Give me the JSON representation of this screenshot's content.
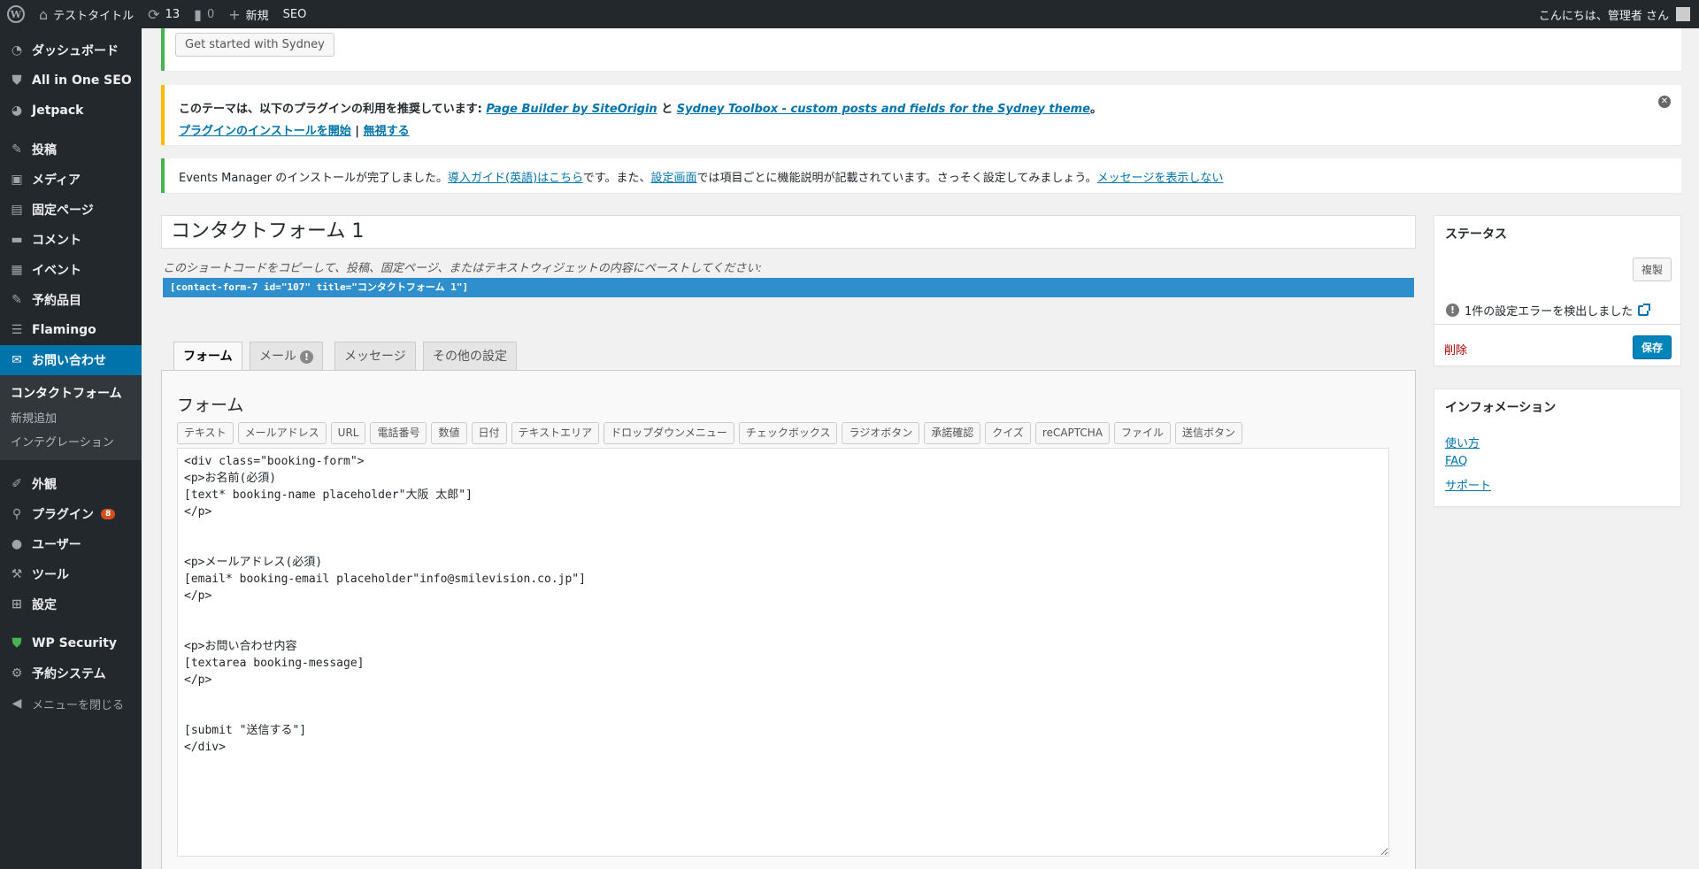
{
  "adminbar": {
    "site_title": "テストタイトル",
    "updates_count": "13",
    "comments_count": "0",
    "new_label": "新規",
    "seo_label": "SEO",
    "greeting": "こんにちは、管理者 さん"
  },
  "sidebar": {
    "items": [
      {
        "label": "ダッシュボード",
        "icon": "dashboard-icon"
      },
      {
        "label": "All in One SEO",
        "icon": "shield-icon"
      },
      {
        "label": "Jetpack",
        "icon": "jetpack-icon"
      },
      {
        "label": "投稿",
        "icon": "pin-icon"
      },
      {
        "label": "メディア",
        "icon": "media-icon"
      },
      {
        "label": "固定ページ",
        "icon": "page-icon"
      },
      {
        "label": "コメント",
        "icon": "comment-icon"
      },
      {
        "label": "イベント",
        "icon": "calendar-icon"
      },
      {
        "label": "予約品目",
        "icon": "pin-icon"
      },
      {
        "label": "Flamingo",
        "icon": "list-icon"
      },
      {
        "label": "お問い合わせ",
        "icon": "mail-icon"
      },
      {
        "label": "外観",
        "icon": "brush-icon"
      },
      {
        "label": "プラグイン",
        "icon": "plugin-icon",
        "badge": "8"
      },
      {
        "label": "ユーザー",
        "icon": "user-icon"
      },
      {
        "label": "ツール",
        "icon": "wrench-icon"
      },
      {
        "label": "設定",
        "icon": "settings-icon"
      },
      {
        "label": "WP Security",
        "icon": "security-shield-icon"
      },
      {
        "label": "予約システム",
        "icon": "gear-icon"
      },
      {
        "label": "メニューを閉じる",
        "icon": "collapse-icon"
      }
    ],
    "submenu": [
      "コンタクトフォーム",
      "新規追加",
      "インテグレーション"
    ]
  },
  "notices": {
    "sydney_button": "Get started with Sydney",
    "recommend_text": "このテーマは、以下のプラグインの利用を推奨しています: ",
    "plugin1": "Page Builder by SiteOrigin",
    "and": " と ",
    "plugin2": "Sydney Toolbox - custom posts and fields for the Sydney theme",
    "period": "。",
    "install_link": "プラグインのインストールを開始",
    "separator": " | ",
    "dismiss_link": "無視する",
    "em_text1": "Events Manager のインストールが完了しました。",
    "em_link1": "導入ガイド(英語)はこちら",
    "em_text2": "です。また、",
    "em_link2": "設定画面",
    "em_text3": "では項目ごとに機能説明が記載されています。さっそく設定してみましょう。",
    "em_link3": "メッセージを表示しない"
  },
  "form": {
    "title": "コンタクトフォーム 1",
    "shortcode_desc": "このショートコードをコピーして、投稿、固定ページ、またはテキストウィジェットの内容にペーストしてください:",
    "shortcode": "[contact-form-7 id=\"107\" title=\"コンタクトフォーム 1\"]",
    "tabs": [
      "フォーム",
      "メール",
      "メッセージ",
      "その他の設定"
    ],
    "panel_title": "フォーム",
    "tags": [
      "テキスト",
      "メールアドレス",
      "URL",
      "電話番号",
      "数値",
      "日付",
      "テキストエリア",
      "ドロップダウンメニュー",
      "チェックボックス",
      "ラジオボタン",
      "承諾確認",
      "クイズ",
      "reCAPTCHA",
      "ファイル",
      "送信ボタン"
    ],
    "editor_content": "<div class=\"booking-form\">\n<p>お名前(必須)\n[text* booking-name placeholder\"大阪 太郎\"]\n</p>\n\n\n<p>メールアドレス(必須)\n[email* booking-email placeholder\"info@smilevision.co.jp\"]\n</p>\n\n\n<p>お問い合わせ内容\n[textarea booking-message]\n</p>\n\n\n[submit \"送信する\"]\n</div>"
  },
  "status_box": {
    "title": "ステータス",
    "duplicate_label": "複製",
    "error_text": "1件の設定エラーを検出しました",
    "delete_label": "削除",
    "save_label": "保存"
  },
  "info_box": {
    "title": "インフォメーション",
    "links": [
      "使い方",
      "FAQ",
      "サポート"
    ]
  }
}
